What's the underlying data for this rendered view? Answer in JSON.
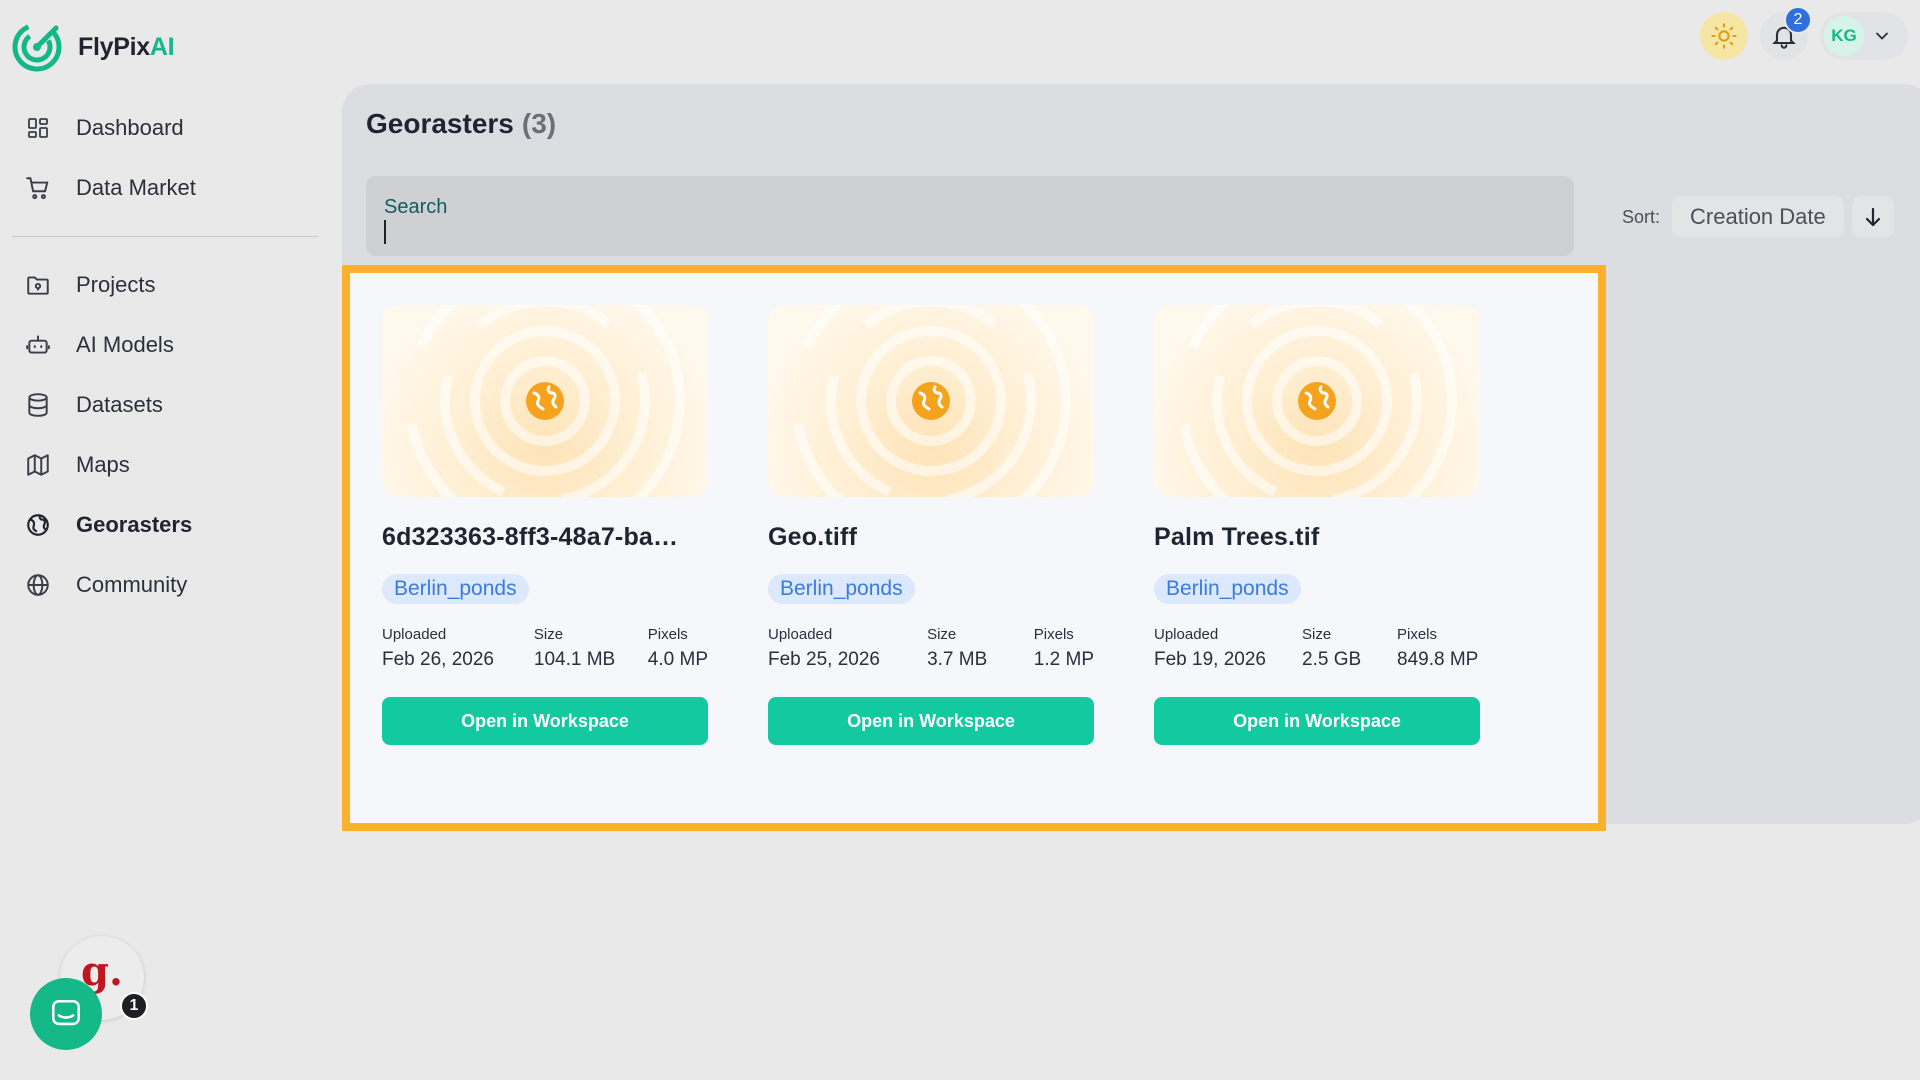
{
  "brand": {
    "name_part1": "FlyPix",
    "name_part2": "AI"
  },
  "sidebar": {
    "items_top": [
      {
        "label": "Dashboard",
        "icon": "dashboard-icon"
      },
      {
        "label": "Data Market",
        "icon": "cart-icon"
      }
    ],
    "items_bottom": [
      {
        "label": "Projects",
        "icon": "folder-icon"
      },
      {
        "label": "AI Models",
        "icon": "robot-icon"
      },
      {
        "label": "Datasets",
        "icon": "database-icon"
      },
      {
        "label": "Maps",
        "icon": "map-icon"
      },
      {
        "label": "Georasters",
        "icon": "globe-grid-icon"
      },
      {
        "label": "Community",
        "icon": "globe-icon"
      }
    ]
  },
  "topbar": {
    "notifications_count": "2",
    "user_initials": "KG"
  },
  "page": {
    "title": "Georasters",
    "count": "(3)",
    "search_placeholder": "Search",
    "sort_label": "Sort:",
    "sort_value": "Creation Date"
  },
  "cards": [
    {
      "name": "6d323363-8ff3-48a7-ba…",
      "tag": "Berlin_ponds",
      "uploaded_label": "Uploaded",
      "uploaded": "Feb 26, 2026",
      "size_label": "Size",
      "size": "104.1 MB",
      "pixels_label": "Pixels",
      "pixels": "4.0 MP",
      "button": "Open in Workspace"
    },
    {
      "name": "Geo.tiff",
      "tag": "Berlin_ponds",
      "uploaded_label": "Uploaded",
      "uploaded": "Feb 25, 2026",
      "size_label": "Size",
      "size": "3.7 MB",
      "pixels_label": "Pixels",
      "pixels": "1.2 MP",
      "button": "Open in Workspace"
    },
    {
      "name": "Palm Trees.tif",
      "tag": "Berlin_ponds",
      "uploaded_label": "Uploaded",
      "uploaded": "Feb 19, 2026",
      "size_label": "Size",
      "size": "2.5 GB",
      "pixels_label": "Pixels",
      "pixels": "849.8 MP",
      "button": "Open in Workspace"
    }
  ],
  "widgets": {
    "g_letter": "g.",
    "chat_badge": "1"
  },
  "colors": {
    "accent": "#12c9a0",
    "brand_green": "#12b886",
    "highlight_frame": "#fbb12c",
    "tag_blue": "#3a7be0"
  }
}
